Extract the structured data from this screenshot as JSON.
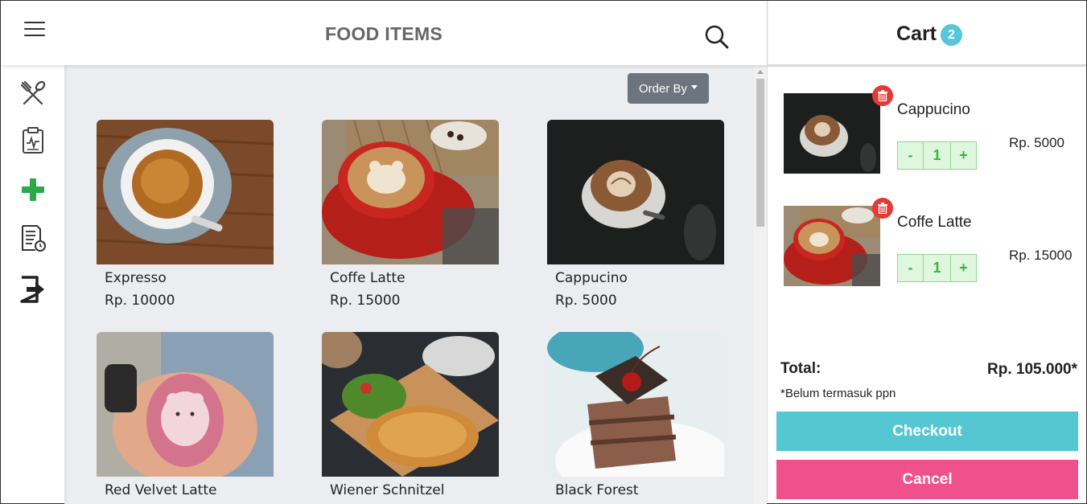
{
  "header": {
    "title": "FOOD ITEMS"
  },
  "icons": {
    "menu": "hamburger-icon",
    "search": "search-icon",
    "sidebar": [
      "utensils-icon",
      "clipboard-icon",
      "add-icon",
      "report-icon",
      "logout-icon"
    ]
  },
  "toolbar": {
    "order_by_label": "Order By"
  },
  "products": [
    {
      "name": "Expresso",
      "price": "Rp. 10000"
    },
    {
      "name": "Coffe Latte",
      "price": "Rp. 15000"
    },
    {
      "name": "Cappucino",
      "price": "Rp. 5000"
    },
    {
      "name": "Red Velvet Latte",
      "price": ""
    },
    {
      "name": "Wiener Schnitzel",
      "price": ""
    },
    {
      "name": "Black Forest",
      "price": ""
    }
  ],
  "cart": {
    "title": "Cart",
    "count": "2",
    "items": [
      {
        "name": "Cappucino",
        "price": "Rp. 5000",
        "qty": "1",
        "minus": "-",
        "plus": "+"
      },
      {
        "name": "Coffe Latte",
        "price": "Rp. 15000",
        "qty": "1",
        "minus": "-",
        "plus": "+"
      }
    ],
    "total_label": "Total:",
    "total_value": "Rp. 105.000*",
    "note": "*Belum termasuk ppn",
    "checkout_label": "Checkout",
    "cancel_label": "Cancel"
  },
  "colors": {
    "accent_teal": "#55c7d3",
    "cancel_pink": "#f0508b",
    "add_green": "#2ba84a",
    "delete_red": "#e53935"
  }
}
